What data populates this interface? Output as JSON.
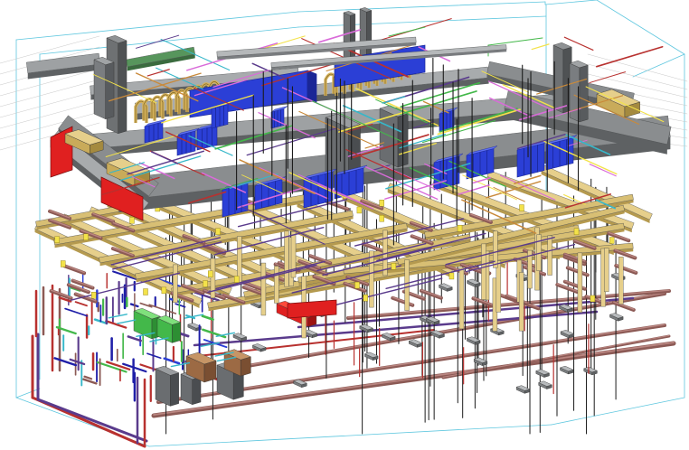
{
  "view": {
    "kind": "isometric 3D BIM model view (MEP coordination)",
    "background": "#ffffff"
  },
  "colors": {
    "section_box": "#5fc7df",
    "duct_gray": "#8a8d8f",
    "duct_dark": "#5e6163",
    "duct_light": "#b9bcbe",
    "duct_tan": "#e6cf8b",
    "tan_dark": "#b59a4f",
    "pipe_brown": "#8c5a55",
    "pipe_brown_light": "#b98580",
    "pipe_purple": "#5a3b8c",
    "pipe_red": "#b8312f",
    "equip_red": "#e02020",
    "blue_equip": "#2b3fd6",
    "blue_dark": "#1a2696",
    "yellow": "#f3e24a",
    "green": "#43b84a",
    "cyan_pipe": "#36b7c9",
    "orange": "#c98a3b",
    "black_line": "#1b1b1b"
  },
  "icons": [
    "isometric-building-services-model"
  ]
}
